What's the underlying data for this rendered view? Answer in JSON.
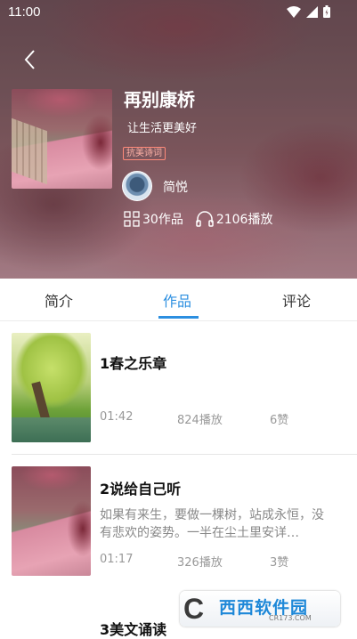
{
  "status_bar": {
    "time": "11:00"
  },
  "album": {
    "title": "再别康桥",
    "subtitle": "让生活更美好",
    "tag": "抗美诗词",
    "author": "简悦",
    "works_count": "30作品",
    "play_count": "2106播放"
  },
  "tabs": [
    {
      "label": "简介",
      "active": false
    },
    {
      "label": "作品",
      "active": true
    },
    {
      "label": "评论",
      "active": false
    }
  ],
  "items": [
    {
      "title": "1春之乐章",
      "desc": "",
      "duration": "01:42",
      "plays": "824播放",
      "likes": "6赞"
    },
    {
      "title": "2说给自己听",
      "desc": "如果有来生，要做一棵树，站成永恒，没有悲欢的姿势。一半在尘土里安详…",
      "duration": "01:17",
      "plays": "326播放",
      "likes": "3赞"
    },
    {
      "title": "3美文诵读",
      "desc": "",
      "duration": "",
      "plays": "",
      "likes": ""
    }
  ],
  "watermark": {
    "brand": "西西软件园",
    "url": "CR173.COM"
  },
  "colors": {
    "accent": "#2c8fe0",
    "tag": "#ff8a7a"
  }
}
